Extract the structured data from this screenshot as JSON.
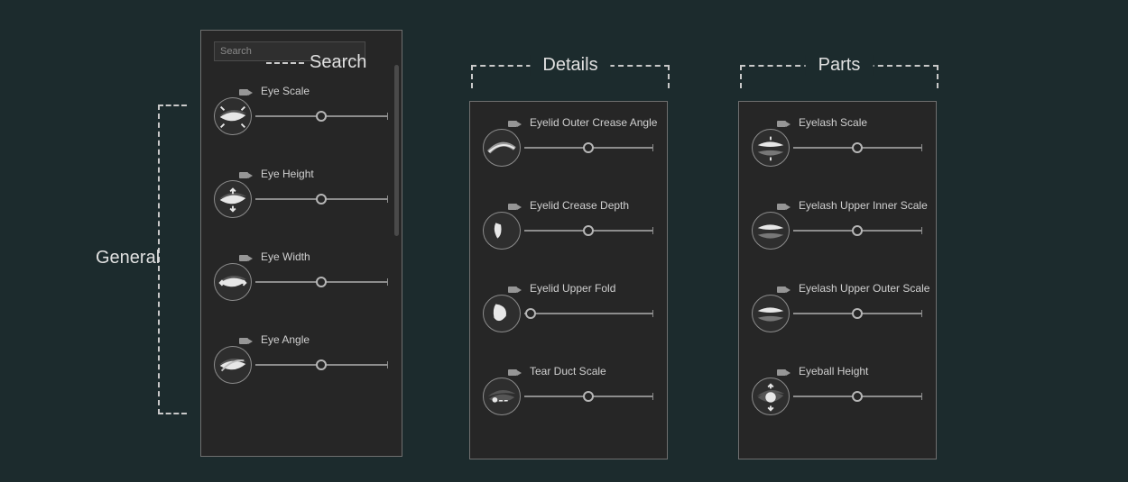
{
  "search": {
    "placeholder": "Search"
  },
  "callouts": {
    "search": "Search",
    "general": "General",
    "details": "Details",
    "parts": "Parts"
  },
  "panels": {
    "general": {
      "sliders": [
        {
          "label": "Eye Scale",
          "value": 0.5,
          "icon": "eye-scale"
        },
        {
          "label": "Eye Height",
          "value": 0.5,
          "icon": "eye-height"
        },
        {
          "label": "Eye Width",
          "value": 0.5,
          "icon": "eye-width"
        },
        {
          "label": "Eye Angle",
          "value": 0.5,
          "icon": "eye-angle"
        }
      ]
    },
    "details": {
      "sliders": [
        {
          "label": "Eyelid Outer Crease Angle",
          "value": 0.5,
          "icon": "eyelid-outer-crease-angle"
        },
        {
          "label": "Eyelid Crease Depth",
          "value": 0.5,
          "icon": "eyelid-crease-depth"
        },
        {
          "label": "Eyelid Upper Fold",
          "value": 0.05,
          "icon": "eyelid-upper-fold"
        },
        {
          "label": "Tear Duct Scale",
          "value": 0.5,
          "icon": "tear-duct-scale"
        }
      ]
    },
    "parts": {
      "sliders": [
        {
          "label": "Eyelash Scale",
          "value": 0.5,
          "icon": "eyelash-scale"
        },
        {
          "label": "Eyelash Upper Inner Scale",
          "value": 0.5,
          "icon": "eyelash-upper-inner-scale"
        },
        {
          "label": "Eyelash Upper Outer Scale",
          "value": 0.5,
          "icon": "eyelash-upper-outer-scale"
        },
        {
          "label": "Eyeball Height",
          "value": 0.5,
          "icon": "eyeball-height"
        }
      ]
    }
  }
}
